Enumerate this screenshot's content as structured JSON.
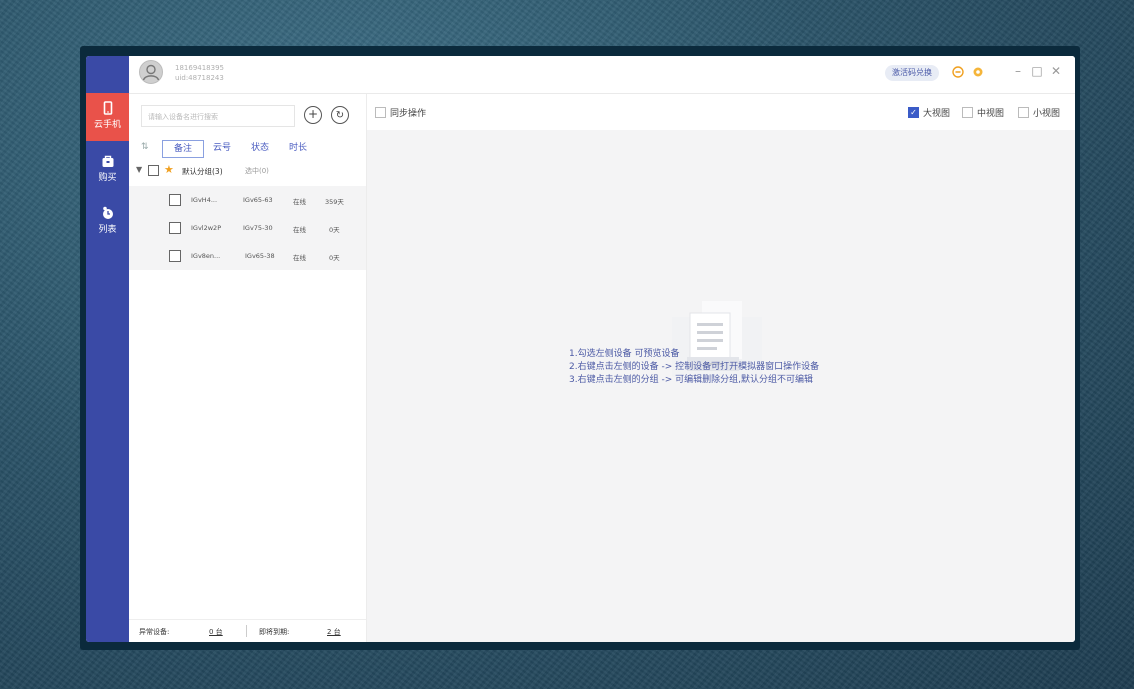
{
  "account": {
    "phone": "18169418395",
    "uid": "uid:48718243"
  },
  "nav": [
    {
      "label": "云手机",
      "icon": "phone-icon",
      "active": true
    },
    {
      "label": "购买",
      "icon": "shopping-bag-icon",
      "active": false
    },
    {
      "label": "列表",
      "icon": "list-clock-icon",
      "active": false
    }
  ],
  "header": {
    "redeem_label": "激活码兑换",
    "icons": [
      "gift-icon",
      "settings-icon"
    ]
  },
  "window_controls": {
    "minimize": "–",
    "maximize": "□",
    "close": "✕"
  },
  "search": {
    "placeholder": "请输入设备名进行搜索"
  },
  "sort_tabs": [
    "备注",
    "云号",
    "状态",
    "时长"
  ],
  "group": {
    "name": "默认分组(3)",
    "selected": "选中(0)"
  },
  "devices": [
    {
      "name": "IGvH4...",
      "id": "IGv65-63",
      "status": "在线",
      "time": "359天"
    },
    {
      "name": "IGvl2w2P",
      "id": "IGv75-30",
      "status": "在线",
      "time": "0天"
    },
    {
      "name": "IGv8en...",
      "id": "IGv65-38",
      "status": "在线",
      "time": "0天"
    }
  ],
  "footer": {
    "abnormal_label": "异常设备:",
    "abnormal_value": "0 台",
    "expiring_label": "即将到期:",
    "expiring_value": "2 台"
  },
  "toolbar": {
    "sync_label": "同步操作",
    "views": [
      {
        "label": "大视图",
        "checked": true
      },
      {
        "label": "中视图",
        "checked": false
      },
      {
        "label": "小视图",
        "checked": false
      }
    ]
  },
  "hints": [
    "1.勾选左侧设备 可预览设备",
    "2.右键点击左侧的设备 -> 控制设备可打开模拟器窗口操作设备",
    "3.右键点击左侧的分组 -> 可编辑删除分组,默认分组不可编辑"
  ],
  "colors": {
    "nav_bg": "#3a4aa6",
    "nav_active": "#e9524a",
    "accent": "#4a5cc0",
    "star": "#f0a020"
  }
}
